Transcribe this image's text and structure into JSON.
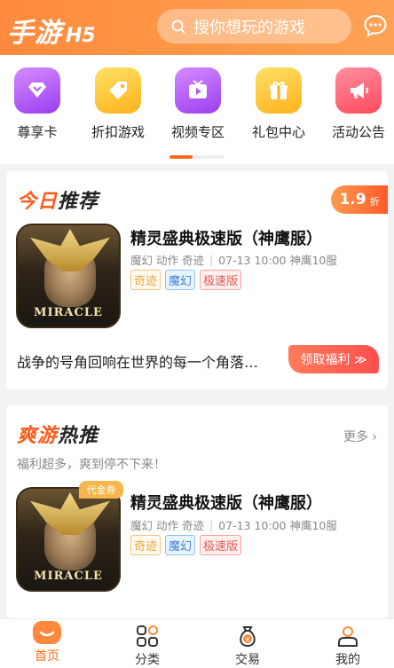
{
  "header": {
    "logo_main": "手游",
    "logo_sub": "H5",
    "search_placeholder": "搜你想玩的游戏",
    "message_icon": "chat-bubble-icon"
  },
  "quick_nav": [
    {
      "label": "尊享卡",
      "icon": "vip-card-icon",
      "color": "#b35cf0"
    },
    {
      "label": "折扣游戏",
      "icon": "discount-tag-icon",
      "color": "#ffc22a"
    },
    {
      "label": "视频专区",
      "icon": "video-play-icon",
      "color": "#b35cf0"
    },
    {
      "label": "礼包中心",
      "icon": "gift-box-icon",
      "color": "#ffc22a"
    },
    {
      "label": "活动公告",
      "icon": "megaphone-icon",
      "color": "#ff5a6a"
    }
  ],
  "today": {
    "title_a": "今日",
    "title_b": "推荐",
    "discount_value": "1.9",
    "discount_unit": "折",
    "game": {
      "name": "精灵盛典极速版（神鹰服）",
      "genres": "魔幻 动作 奇迹",
      "release": "07-13 10:00 神鹰10服",
      "tags": [
        "奇迹",
        "魔幻",
        "极速版"
      ],
      "icon_caption": "MIRACLE"
    },
    "description": "战争的号角回响在世界的每一个角落…",
    "cta": "领取福利 ≫"
  },
  "hot": {
    "title_a": "爽游",
    "title_b": "热推",
    "more": "更多",
    "slogan": "福利超多，爽到停不下来！",
    "game": {
      "name": "精灵盛典极速版（神鹰服）",
      "genres": "魔幻 动作 奇迹",
      "release": "07-13 10:00 神鹰10服",
      "tags": [
        "奇迹",
        "魔幻",
        "极速版"
      ],
      "badge": "代金券",
      "icon_caption": "MIRACLE"
    }
  },
  "tabbar": [
    {
      "label": "首页",
      "icon": "home-icon",
      "active": true
    },
    {
      "label": "分类",
      "icon": "category-grid-icon",
      "active": false
    },
    {
      "label": "交易",
      "icon": "trade-money-icon",
      "active": false
    },
    {
      "label": "我的",
      "icon": "profile-icon",
      "active": false
    }
  ],
  "colors": {
    "accent": "#ff6a1a",
    "header": "#ff9a4a"
  }
}
